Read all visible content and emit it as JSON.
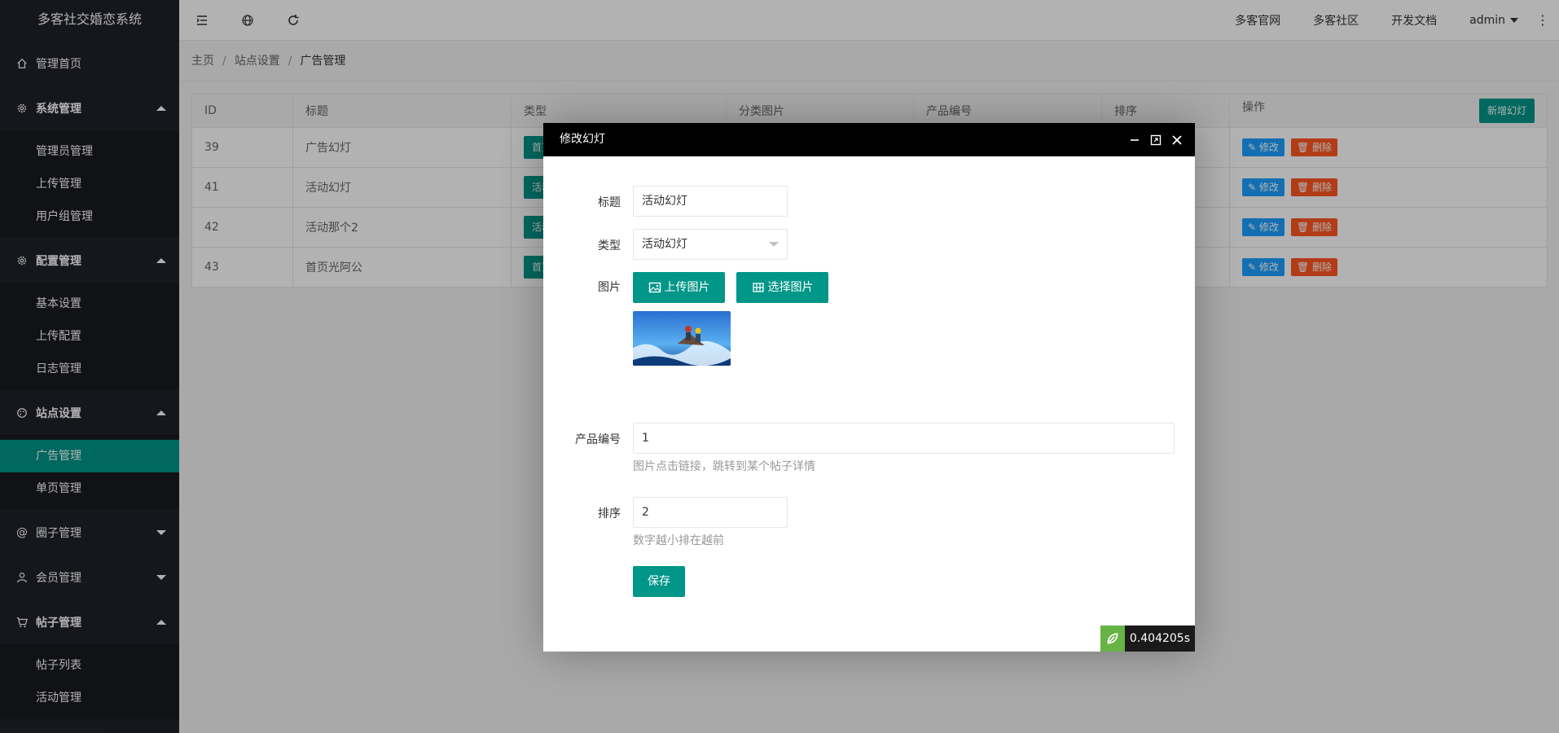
{
  "app": {
    "title": "多客社交婚恋系统"
  },
  "sidebar": {
    "home": "管理首页",
    "groups": [
      {
        "label": "系统管理",
        "icon": "gear-icon",
        "expanded": true,
        "children": [
          "管理员管理",
          "上传管理",
          "用户组管理"
        ]
      },
      {
        "label": "配置管理",
        "icon": "gear-icon",
        "expanded": true,
        "children": [
          "基本设置",
          "上传配置",
          "日志管理"
        ]
      },
      {
        "label": "站点设置",
        "icon": "palette-icon",
        "expanded": true,
        "children": [
          "广告管理",
          "单页管理"
        ],
        "active": "广告管理"
      },
      {
        "label": "圈子管理",
        "icon": "at-icon",
        "expanded": false,
        "children": []
      },
      {
        "label": "会员管理",
        "icon": "user-icon",
        "expanded": false,
        "children": []
      },
      {
        "label": "帖子管理",
        "icon": "cart-icon",
        "expanded": true,
        "children": [
          "帖子列表",
          "活动管理"
        ]
      }
    ]
  },
  "header": {
    "links": [
      "多客官网",
      "多客社区",
      "开发文档"
    ],
    "user": "admin",
    "more": "⋮"
  },
  "breadcrumb": {
    "items": [
      "主页",
      "站点设置",
      "广告管理"
    ],
    "sep": "/"
  },
  "table": {
    "headers": [
      "ID",
      "标题",
      "类型",
      "分类图片",
      "产品编号",
      "排序",
      "操作"
    ],
    "add_button": "新增幻灯",
    "edit_label": "修改",
    "delete_label": "删除",
    "rows": [
      {
        "id": "39",
        "title": "广告幻灯",
        "type": "首页"
      },
      {
        "id": "41",
        "title": "活动幻灯",
        "type": "活动"
      },
      {
        "id": "42",
        "title": "活动那个2",
        "type": "活动"
      },
      {
        "id": "43",
        "title": "首页光阿公",
        "type": "首页"
      }
    ]
  },
  "modal": {
    "title": "修改幻灯",
    "fields": {
      "title_label": "标题",
      "title_value": "活动幻灯",
      "type_label": "类型",
      "type_value": "活动幻灯",
      "image_label": "图片",
      "upload_button": "上传图片",
      "select_button": "选择图片",
      "product_label": "产品编号",
      "product_value": "1",
      "product_hint": "图片点击链接，跳转到某个帖子详情",
      "sort_label": "排序",
      "sort_value": "2",
      "sort_hint": "数字越小排在越前",
      "save_button": "保存"
    }
  },
  "timer": {
    "value": "0.404205s"
  },
  "colors": {
    "primary": "#009688",
    "sidebar": "#20222a",
    "edit": "#1e9fff",
    "delete": "#ff5722"
  }
}
